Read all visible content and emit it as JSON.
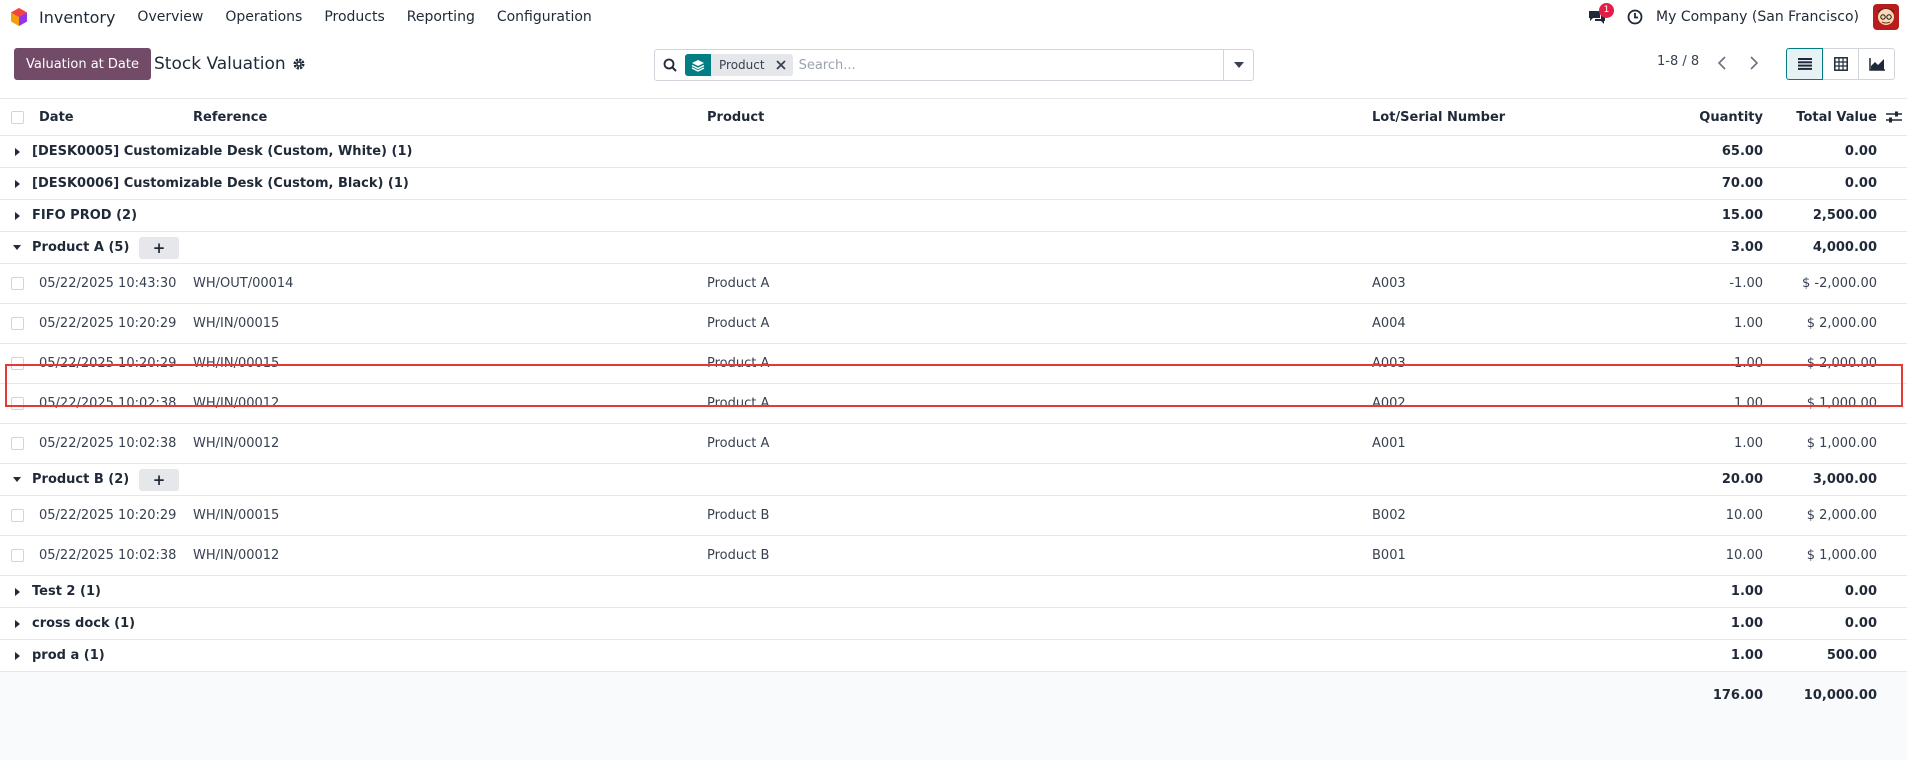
{
  "navbar": {
    "app_name": "Inventory",
    "menu": [
      "Overview",
      "Operations",
      "Products",
      "Reporting",
      "Configuration"
    ],
    "chat_badge": "1",
    "company": "My Company (San Francisco)"
  },
  "control_panel": {
    "valuation_button": "Valuation at Date",
    "title": "Stock Valuation",
    "search": {
      "facet_label": "Product",
      "placeholder": "Search..."
    },
    "pager": "1-8 / 8"
  },
  "table": {
    "columns": [
      "Date",
      "Reference",
      "Product",
      "Lot/Serial Number",
      "Quantity",
      "Total Value"
    ],
    "groups": [
      {
        "label": "[DESK0005] Customizable Desk (Custom, White) (1)",
        "expanded": false,
        "quantity": "65.00",
        "total": "0.00",
        "records": []
      },
      {
        "label": "[DESK0006] Customizable Desk (Custom, Black) (1)",
        "expanded": false,
        "quantity": "70.00",
        "total": "0.00",
        "records": []
      },
      {
        "label": "FIFO PROD (2)",
        "expanded": false,
        "quantity": "15.00",
        "total": "2,500.00",
        "records": []
      },
      {
        "label": "Product A (5)",
        "expanded": true,
        "quantity": "3.00",
        "total": "4,000.00",
        "records": [
          {
            "date": "05/22/2025 10:43:30",
            "reference": "WH/OUT/00014",
            "product": "Product A",
            "lot": "A003",
            "quantity": "-1.00",
            "total": "$ -2,000.00"
          },
          {
            "date": "05/22/2025 10:20:29",
            "reference": "WH/IN/00015",
            "product": "Product A",
            "lot": "A004",
            "quantity": "1.00",
            "total": "$ 2,000.00"
          },
          {
            "date": "05/22/2025 10:20:29",
            "reference": "WH/IN/00015",
            "product": "Product A",
            "lot": "A003",
            "quantity": "1.00",
            "total": "$ 2,000.00"
          },
          {
            "date": "05/22/2025 10:02:38",
            "reference": "WH/IN/00012",
            "product": "Product A",
            "lot": "A002",
            "quantity": "1.00",
            "total": "$ 1,000.00"
          },
          {
            "date": "05/22/2025 10:02:38",
            "reference": "WH/IN/00012",
            "product": "Product A",
            "lot": "A001",
            "quantity": "1.00",
            "total": "$ 1,000.00"
          }
        ]
      },
      {
        "label": "Product B (2)",
        "expanded": true,
        "quantity": "20.00",
        "total": "3,000.00",
        "records": [
          {
            "date": "05/22/2025 10:20:29",
            "reference": "WH/IN/00015",
            "product": "Product B",
            "lot": "B002",
            "quantity": "10.00",
            "total": "$ 2,000.00"
          },
          {
            "date": "05/22/2025 10:02:38",
            "reference": "WH/IN/00012",
            "product": "Product B",
            "lot": "B001",
            "quantity": "10.00",
            "total": "$ 1,000.00"
          }
        ]
      },
      {
        "label": "Test 2 (1)",
        "expanded": false,
        "quantity": "1.00",
        "total": "0.00",
        "records": []
      },
      {
        "label": "cross dock (1)",
        "expanded": false,
        "quantity": "1.00",
        "total": "0.00",
        "records": []
      },
      {
        "label": "prod a (1)",
        "expanded": false,
        "quantity": "1.00",
        "total": "500.00",
        "records": []
      }
    ],
    "footer": {
      "quantity": "176.00",
      "total": "10,000.00"
    }
  },
  "colors": {
    "primary": "#714b67",
    "accent": "#017e84",
    "highlight": "#e53935",
    "badge": "#e11d48"
  },
  "icons": [
    "app-logo-icon",
    "chat-icon",
    "clock-icon",
    "gear-icon",
    "search-icon",
    "layers-icon",
    "close-icon",
    "caret-down-icon",
    "chevron-left-icon",
    "chevron-right-icon",
    "list-view-icon",
    "pivot-view-icon",
    "graph-view-icon",
    "caret-right-icon",
    "plus-icon",
    "settings-sliders-icon"
  ]
}
